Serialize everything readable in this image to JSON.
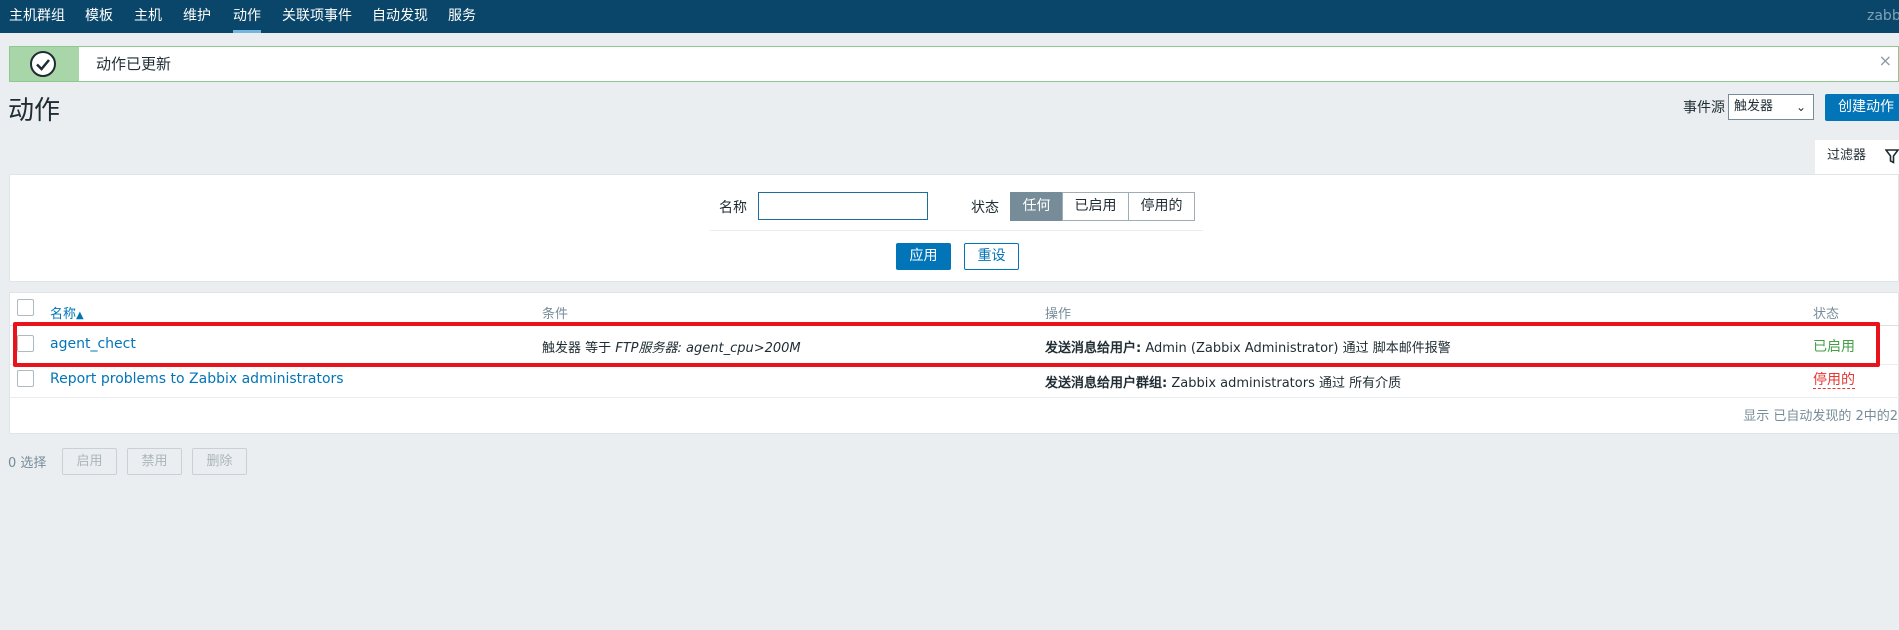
{
  "topnav": {
    "items": [
      {
        "label": "主机群组",
        "active": false
      },
      {
        "label": "模板",
        "active": false
      },
      {
        "label": "主机",
        "active": false
      },
      {
        "label": "维护",
        "active": false
      },
      {
        "label": "动作",
        "active": true
      },
      {
        "label": "关联项事件",
        "active": false
      },
      {
        "label": "自动发现",
        "active": false
      },
      {
        "label": "服务",
        "active": false
      }
    ],
    "brand": "zabbix"
  },
  "message": {
    "text": "动作已更新",
    "icon": "checkmark-icon",
    "close_icon": "×"
  },
  "page": {
    "title": "动作"
  },
  "header_controls": {
    "event_source_label": "事件源",
    "event_source_value": "触发器",
    "chevron": "⌄",
    "create_button": "创建动作"
  },
  "filter": {
    "tab_label": "过滤器",
    "name_label": "名称",
    "name_value": "",
    "status_label": "状态",
    "status_options": [
      "任何",
      "已启用",
      "停用的"
    ],
    "status_selected": "任何",
    "apply_label": "应用",
    "reset_label": "重设"
  },
  "table": {
    "columns": {
      "name": "名称",
      "sort_arrow": "▲",
      "conditions": "条件",
      "operations": "操作",
      "status": "状态"
    },
    "rows": [
      {
        "name": "agent_chect",
        "condition_prefix": "触发器 等于 ",
        "condition_value": "FTP服务器: agent_cpu>200M",
        "operation_label": "发送消息给用户:",
        "operation_text": " Admin (Zabbix Administrator) 通过 脚本邮件报警",
        "status": "已启用"
      },
      {
        "name": "Report problems to Zabbix administrators",
        "condition_prefix": "",
        "condition_value": "",
        "operation_label": "发送消息给用户群组:",
        "operation_text": " Zabbix administrators 通过 所有介质",
        "status": "停用的"
      }
    ],
    "pager_text": "显示 已自动发现的 2中的2"
  },
  "footer": {
    "selected_count": "0 选择",
    "enable_label": "启用",
    "disable_label": "禁用",
    "delete_label": "删除"
  },
  "colors": {
    "nav_bg": "#0a466a",
    "accent": "#0275b8",
    "enabled": "#429e47",
    "disabled": "#e33734",
    "highlight": "#e8131b"
  }
}
